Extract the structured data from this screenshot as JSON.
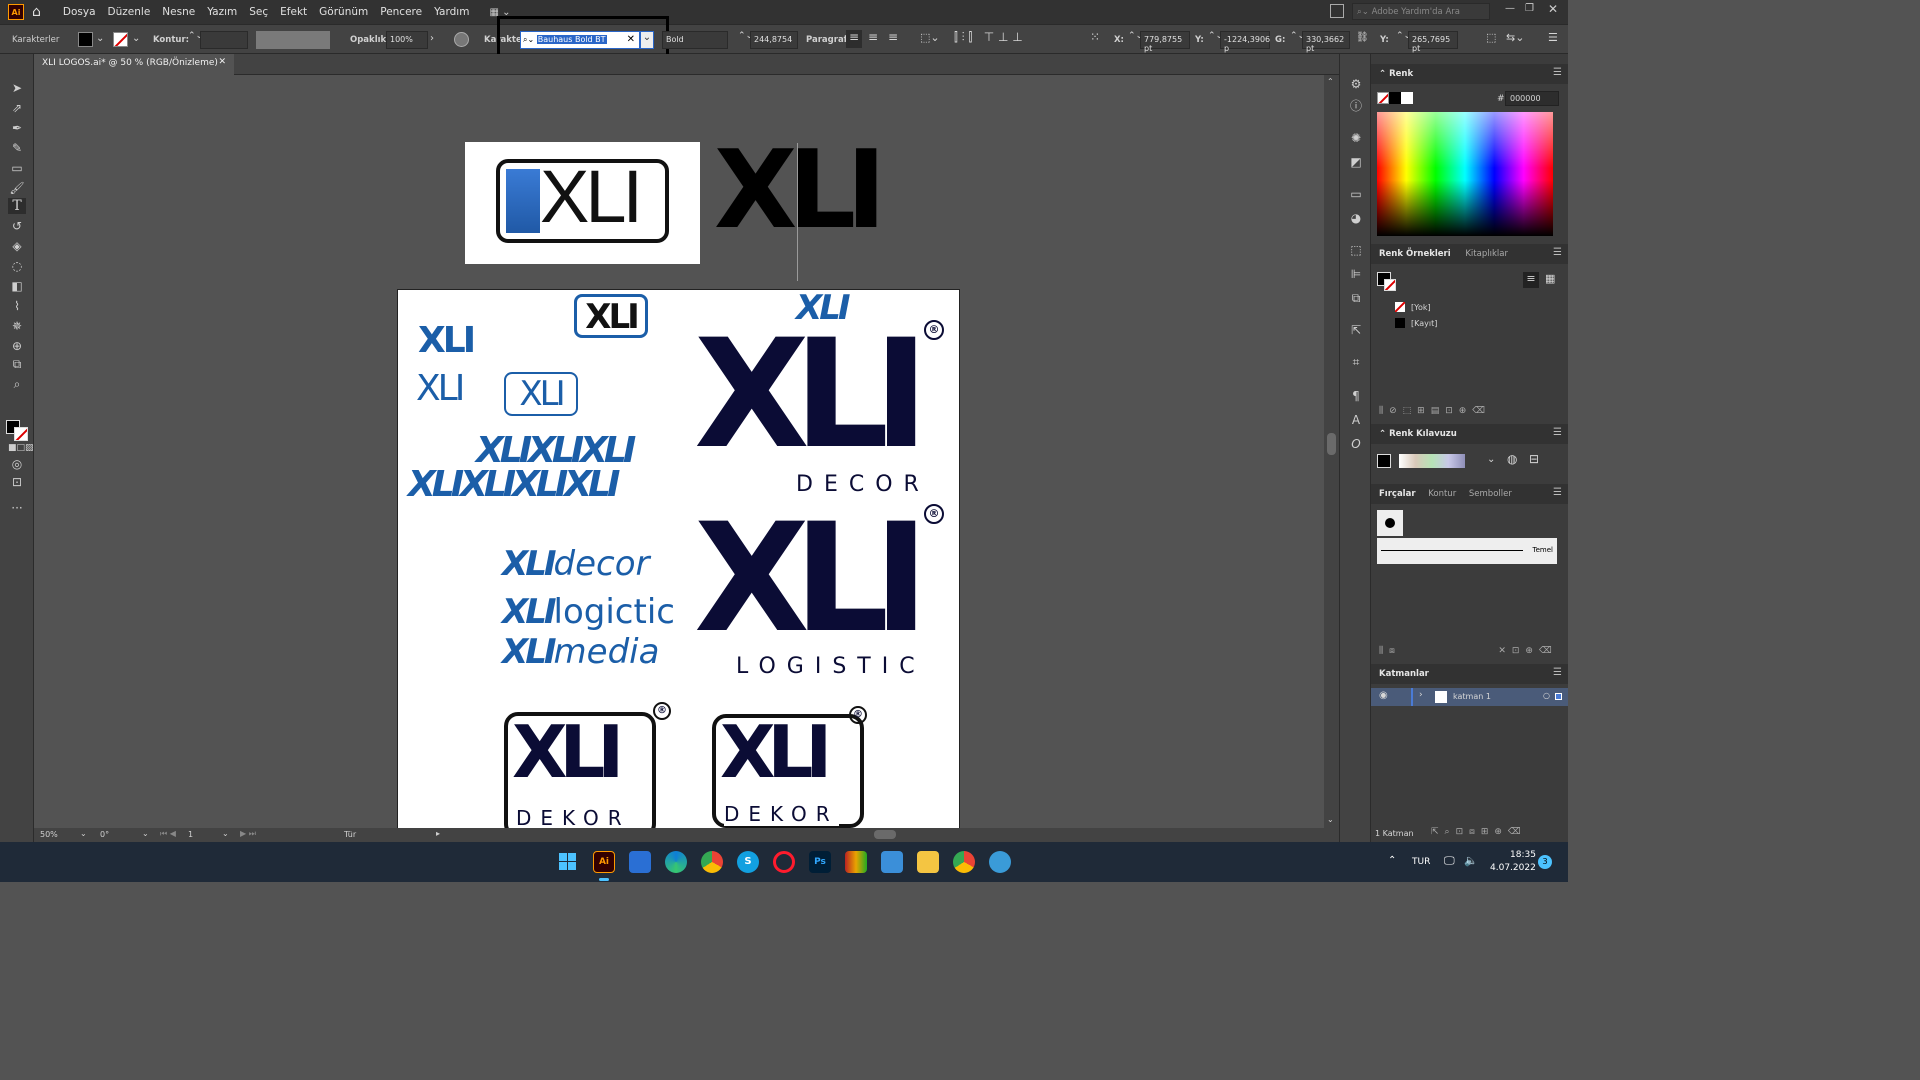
{
  "app": {
    "logo": "Ai",
    "doc_tab": "XLI LOGOS.ai* @ 50 % (RGB/Önizleme)"
  },
  "menu": [
    "Dosya",
    "Düzenle",
    "Nesne",
    "Yazım",
    "Seç",
    "Efekt",
    "Görünüm",
    "Pencere",
    "Yardım"
  ],
  "search": {
    "placeholder": "Adobe Yardım'da Ara"
  },
  "control": {
    "panel_label": "Karakterler",
    "stroke_label": "Kontur:",
    "opacity_label": "Opaklık:",
    "opacity_value": "100%",
    "char_label": "Karakter:",
    "font_value": "Bauhaus Bold BT",
    "style_value": "Bold",
    "size_value": "244,8754",
    "paragraph_label": "Paragraf:",
    "x_label": "X:",
    "x_value": "779,8755 pt",
    "y_label": "Y:",
    "y_value": "-1224,3906 p",
    "w_label": "G:",
    "w_value": "330,3662 pt",
    "h_label": "Y:",
    "h_value": "265,7695 pt"
  },
  "panels": {
    "color": {
      "title": "Renk",
      "hex_label": "#",
      "hex": "000000"
    },
    "swatches": {
      "tab1": "Renk Örnekleri",
      "tab2": "Kitaplıklar",
      "items": [
        "[Yok]",
        "[Kayıt]"
      ]
    },
    "guide": {
      "title": "Renk Kılavuzu"
    },
    "brushes": {
      "tab1": "Fırçalar",
      "tab2": "Kontur",
      "tab3": "Semboller",
      "basic": "Temel"
    },
    "layers": {
      "title": "Katmanlar",
      "layer": "katman 1",
      "footer": "1 Katman"
    }
  },
  "status": {
    "zoom": "50%",
    "rotation": "0°",
    "artboard": "1",
    "tool": "Tür"
  },
  "artwork": {
    "logo_main": "XLI",
    "decor_word": "DECOR",
    "logistic_word": "LOGISTIC",
    "dekor_word": "DEKOR",
    "italic_row1": "XLIXLIXLI",
    "italic_row2": "XLIXLIXLIXLI",
    "brand_decor": "decor",
    "brand_logictic": "logictic",
    "brand_media": "media",
    "registered": "®"
  },
  "taskbar": {
    "lang": "TUR",
    "time": "18:35",
    "date": "4.07.2022",
    "badge": "3"
  },
  "colors": {
    "brand_blue": "#1b5ea8",
    "brand_navy": "#0b0c35"
  }
}
